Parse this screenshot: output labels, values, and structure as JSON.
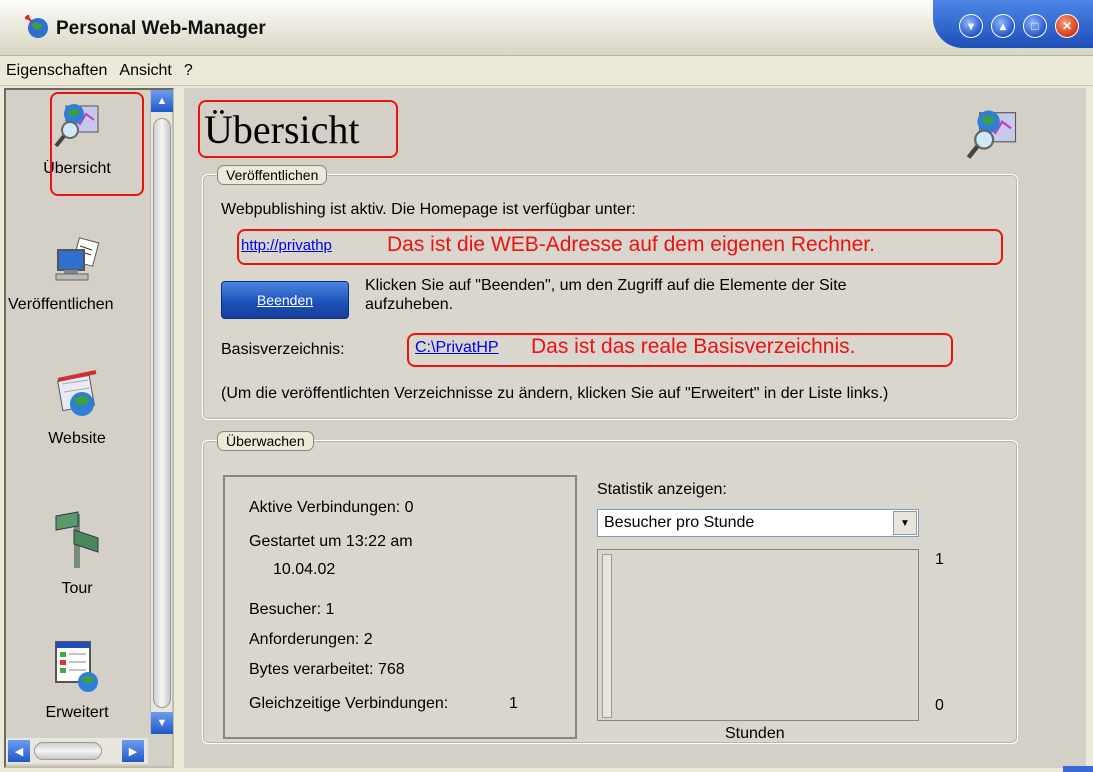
{
  "window": {
    "title": "Personal Web-Manager",
    "controls": [
      "minimize",
      "restore",
      "maximize",
      "close"
    ]
  },
  "menu": [
    {
      "label": "Eigenschaften"
    },
    {
      "label": "Ansicht"
    },
    {
      "label": "?"
    }
  ],
  "sidebar": {
    "items": [
      {
        "label": "Übersicht",
        "icon": "overview-globe-icon"
      },
      {
        "label": "Veröffentlichen",
        "icon": "publish-computer-icon"
      },
      {
        "label": "Website",
        "icon": "website-globe-icon"
      },
      {
        "label": "Tour",
        "icon": "signpost-icon"
      },
      {
        "label": "Erweitert",
        "icon": "advanced-window-icon"
      }
    ]
  },
  "main": {
    "title": "Übersicht",
    "publish_group": {
      "label": "Veröffentlichen",
      "status_text": "Webpublishing ist aktiv. Die Homepage ist verfügbar unter:",
      "homepage_link": "http://privathp",
      "stop_button": "Beenden",
      "stop_hint_line1": "Klicken Sie auf \"Beenden\", um den Zugriff auf die Elemente der Site",
      "stop_hint_line2": "aufzuheben.",
      "basedir_label": "Basisverzeichnis:",
      "basedir_link": "C:\\PrivatHP",
      "footer_hint": "(Um die veröffentlichten Verzeichnisse zu ändern, klicken Sie auf \"Erweitert\" in der Liste links.)"
    },
    "monitor_group": {
      "label": "Überwachen",
      "active_connections": "Aktive Verbindungen:  0",
      "started_line1": "Gestartet um 13:22 am",
      "started_line2": "10.04.02",
      "visitors": "Besucher:  1",
      "requests": "Anforderungen:  2",
      "bytes": "Bytes verarbeitet:  768",
      "concurrent_label": "Gleichzeitige Verbindungen:",
      "concurrent_value": "1",
      "stats_label": "Statistik anzeigen:",
      "stats_selected": "Besucher pro Stunde",
      "graph_max": "1",
      "graph_min": "0",
      "graph_xlabel": "Stunden"
    }
  },
  "annotations": {
    "web_address": "Das ist die WEB-Adresse auf dem eigenen Rechner.",
    "basedir": "Das ist das reale Basisverzeichnis."
  },
  "colors": {
    "annotation_red": "#ee1111",
    "link_blue": "#0000ee",
    "xp_blue": "#2258c8"
  }
}
